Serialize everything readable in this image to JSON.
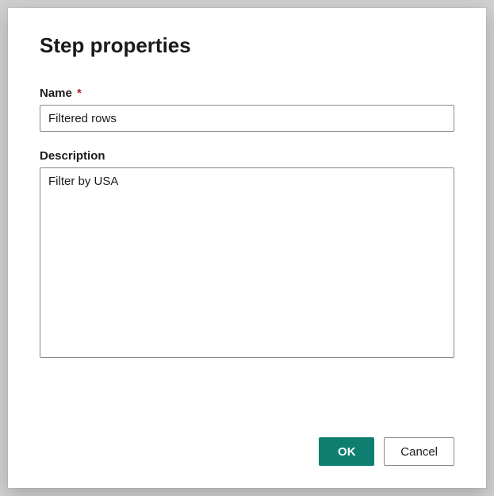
{
  "dialog": {
    "title": "Step properties",
    "name_label": "Name",
    "name_required": "*",
    "name_value": "Filtered rows",
    "description_label": "Description",
    "description_value": "Filter by USA",
    "ok_label": "OK",
    "cancel_label": "Cancel"
  }
}
